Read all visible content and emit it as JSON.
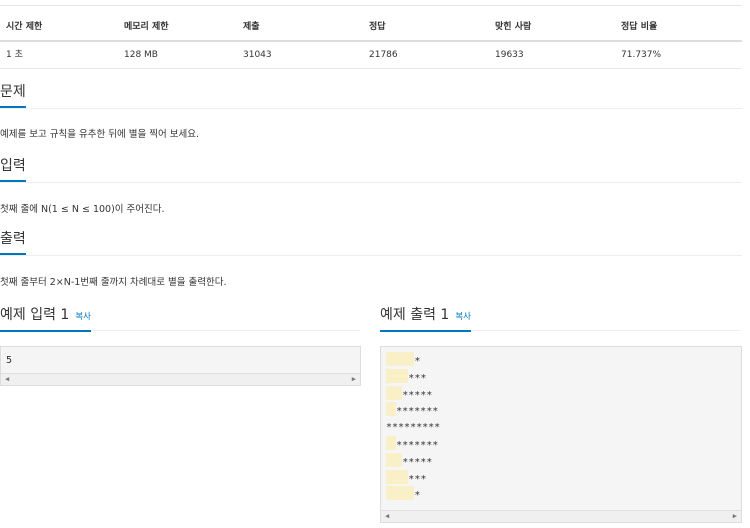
{
  "stats": {
    "headers": [
      "시간 제한",
      "메모리 제한",
      "제출",
      "정답",
      "맞힌 사람",
      "정답 비율"
    ],
    "values": [
      "1 초",
      "128 MB",
      "31043",
      "21786",
      "19633",
      "71.737%"
    ]
  },
  "problem": {
    "title": "문제",
    "text": "예제를 보고 규칙을 유추한 뒤에 별을 찍어 보세요."
  },
  "input": {
    "title": "입력",
    "text": "첫째 줄에 N(1 ≤ N ≤ 100)이 주어진다."
  },
  "output": {
    "title": "출력",
    "text": "첫째 줄부터 2×N-1번째 줄까지 차례대로 별을 출력한다."
  },
  "sample_input": {
    "title": "예제 입력 1",
    "copy": "복사",
    "lines": [
      "5"
    ]
  },
  "sample_output": {
    "title": "예제 출력 1",
    "copy": "복사",
    "lines": [
      "    *",
      "   ***",
      "  *****",
      " *******",
      "*********",
      " *******",
      "  *****",
      "   ***",
      "    *"
    ],
    "leading_spaces": [
      4,
      3,
      2,
      1,
      0,
      1,
      2,
      3,
      4
    ],
    "stars": [
      "*",
      "***",
      "*****",
      "*******",
      "*********",
      "*******",
      "*****",
      "***",
      "*"
    ]
  },
  "scroll": {
    "left": "◀",
    "right": "▶"
  },
  "colors": {
    "accent": "#0076c0",
    "highlight": "#faf0c8",
    "code_bg": "#f5f5f5"
  }
}
